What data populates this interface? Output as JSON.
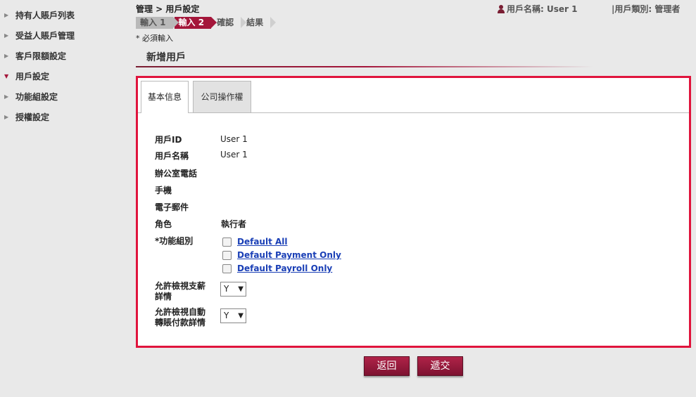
{
  "sidebar": {
    "items": [
      {
        "label": "持有人賬戶列表",
        "arrow": "▶",
        "active": false
      },
      {
        "label": "受益人賬戶管理",
        "arrow": "▶",
        "active": false
      },
      {
        "label": "客戶限額設定",
        "arrow": "▶",
        "active": false
      },
      {
        "label": "用戶設定",
        "arrow": "▼",
        "active": true
      },
      {
        "label": "功能組設定",
        "arrow": "▶",
        "active": false
      },
      {
        "label": "授權設定",
        "arrow": "▶",
        "active": false
      }
    ]
  },
  "header": {
    "breadcrumb": "管理 > 用戶設定",
    "user_name": "用戶名稱: User 1",
    "user_type": "|用戶類別: 管理者"
  },
  "steps": [
    "輸入 1",
    "輸入 2",
    "確認",
    "結果"
  ],
  "required_note": "* 必須輸入",
  "page_title": "新增用戶",
  "tabs": [
    "基本信息",
    "公司操作權"
  ],
  "form": {
    "user_id_label": "用戶ID",
    "user_id_value": "User 1",
    "user_name_label": "用戶名稱",
    "user_name_value": "User 1",
    "office_phone_label": "辦公室電話",
    "mobile_label": "手機",
    "email_label": "電子郵件",
    "role_label": "角色",
    "role_value": "執行者",
    "function_group_label": "*功能組別",
    "function_groups": [
      "Default All",
      "Default Payment Only",
      "Default Payroll Only"
    ],
    "view_payroll_label_1": "允許檢視支薪",
    "view_payroll_label_2": "詳情",
    "view_payroll_value": "Y",
    "view_autopay_label_1": "允許檢視自動",
    "view_autopay_label_2": "轉賬付款詳情",
    "view_autopay_value": "Y"
  },
  "buttons": {
    "back": "返回",
    "submit": "遞交"
  },
  "colors": {
    "accent": "#a4163a",
    "highlight_border": "#e0143c",
    "link": "#1a3fb6"
  }
}
